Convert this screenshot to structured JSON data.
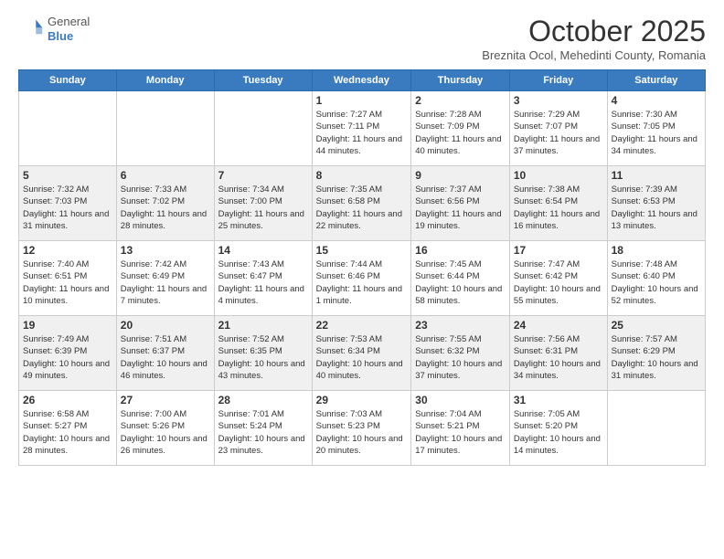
{
  "header": {
    "logo_line1": "General",
    "logo_line2": "Blue",
    "month": "October 2025",
    "location": "Breznita Ocol, Mehedinti County, Romania"
  },
  "weekdays": [
    "Sunday",
    "Monday",
    "Tuesday",
    "Wednesday",
    "Thursday",
    "Friday",
    "Saturday"
  ],
  "weeks": [
    [
      {
        "day": "",
        "info": ""
      },
      {
        "day": "",
        "info": ""
      },
      {
        "day": "",
        "info": ""
      },
      {
        "day": "1",
        "info": "Sunrise: 7:27 AM\nSunset: 7:11 PM\nDaylight: 11 hours\nand 44 minutes."
      },
      {
        "day": "2",
        "info": "Sunrise: 7:28 AM\nSunset: 7:09 PM\nDaylight: 11 hours\nand 40 minutes."
      },
      {
        "day": "3",
        "info": "Sunrise: 7:29 AM\nSunset: 7:07 PM\nDaylight: 11 hours\nand 37 minutes."
      },
      {
        "day": "4",
        "info": "Sunrise: 7:30 AM\nSunset: 7:05 PM\nDaylight: 11 hours\nand 34 minutes."
      }
    ],
    [
      {
        "day": "5",
        "info": "Sunrise: 7:32 AM\nSunset: 7:03 PM\nDaylight: 11 hours\nand 31 minutes."
      },
      {
        "day": "6",
        "info": "Sunrise: 7:33 AM\nSunset: 7:02 PM\nDaylight: 11 hours\nand 28 minutes."
      },
      {
        "day": "7",
        "info": "Sunrise: 7:34 AM\nSunset: 7:00 PM\nDaylight: 11 hours\nand 25 minutes."
      },
      {
        "day": "8",
        "info": "Sunrise: 7:35 AM\nSunset: 6:58 PM\nDaylight: 11 hours\nand 22 minutes."
      },
      {
        "day": "9",
        "info": "Sunrise: 7:37 AM\nSunset: 6:56 PM\nDaylight: 11 hours\nand 19 minutes."
      },
      {
        "day": "10",
        "info": "Sunrise: 7:38 AM\nSunset: 6:54 PM\nDaylight: 11 hours\nand 16 minutes."
      },
      {
        "day": "11",
        "info": "Sunrise: 7:39 AM\nSunset: 6:53 PM\nDaylight: 11 hours\nand 13 minutes."
      }
    ],
    [
      {
        "day": "12",
        "info": "Sunrise: 7:40 AM\nSunset: 6:51 PM\nDaylight: 11 hours\nand 10 minutes."
      },
      {
        "day": "13",
        "info": "Sunrise: 7:42 AM\nSunset: 6:49 PM\nDaylight: 11 hours\nand 7 minutes."
      },
      {
        "day": "14",
        "info": "Sunrise: 7:43 AM\nSunset: 6:47 PM\nDaylight: 11 hours\nand 4 minutes."
      },
      {
        "day": "15",
        "info": "Sunrise: 7:44 AM\nSunset: 6:46 PM\nDaylight: 11 hours\nand 1 minute."
      },
      {
        "day": "16",
        "info": "Sunrise: 7:45 AM\nSunset: 6:44 PM\nDaylight: 10 hours\nand 58 minutes."
      },
      {
        "day": "17",
        "info": "Sunrise: 7:47 AM\nSunset: 6:42 PM\nDaylight: 10 hours\nand 55 minutes."
      },
      {
        "day": "18",
        "info": "Sunrise: 7:48 AM\nSunset: 6:40 PM\nDaylight: 10 hours\nand 52 minutes."
      }
    ],
    [
      {
        "day": "19",
        "info": "Sunrise: 7:49 AM\nSunset: 6:39 PM\nDaylight: 10 hours\nand 49 minutes."
      },
      {
        "day": "20",
        "info": "Sunrise: 7:51 AM\nSunset: 6:37 PM\nDaylight: 10 hours\nand 46 minutes."
      },
      {
        "day": "21",
        "info": "Sunrise: 7:52 AM\nSunset: 6:35 PM\nDaylight: 10 hours\nand 43 minutes."
      },
      {
        "day": "22",
        "info": "Sunrise: 7:53 AM\nSunset: 6:34 PM\nDaylight: 10 hours\nand 40 minutes."
      },
      {
        "day": "23",
        "info": "Sunrise: 7:55 AM\nSunset: 6:32 PM\nDaylight: 10 hours\nand 37 minutes."
      },
      {
        "day": "24",
        "info": "Sunrise: 7:56 AM\nSunset: 6:31 PM\nDaylight: 10 hours\nand 34 minutes."
      },
      {
        "day": "25",
        "info": "Sunrise: 7:57 AM\nSunset: 6:29 PM\nDaylight: 10 hours\nand 31 minutes."
      }
    ],
    [
      {
        "day": "26",
        "info": "Sunrise: 6:58 AM\nSunset: 5:27 PM\nDaylight: 10 hours\nand 28 minutes."
      },
      {
        "day": "27",
        "info": "Sunrise: 7:00 AM\nSunset: 5:26 PM\nDaylight: 10 hours\nand 26 minutes."
      },
      {
        "day": "28",
        "info": "Sunrise: 7:01 AM\nSunset: 5:24 PM\nDaylight: 10 hours\nand 23 minutes."
      },
      {
        "day": "29",
        "info": "Sunrise: 7:03 AM\nSunset: 5:23 PM\nDaylight: 10 hours\nand 20 minutes."
      },
      {
        "day": "30",
        "info": "Sunrise: 7:04 AM\nSunset: 5:21 PM\nDaylight: 10 hours\nand 17 minutes."
      },
      {
        "day": "31",
        "info": "Sunrise: 7:05 AM\nSunset: 5:20 PM\nDaylight: 10 hours\nand 14 minutes."
      },
      {
        "day": "",
        "info": ""
      }
    ]
  ]
}
